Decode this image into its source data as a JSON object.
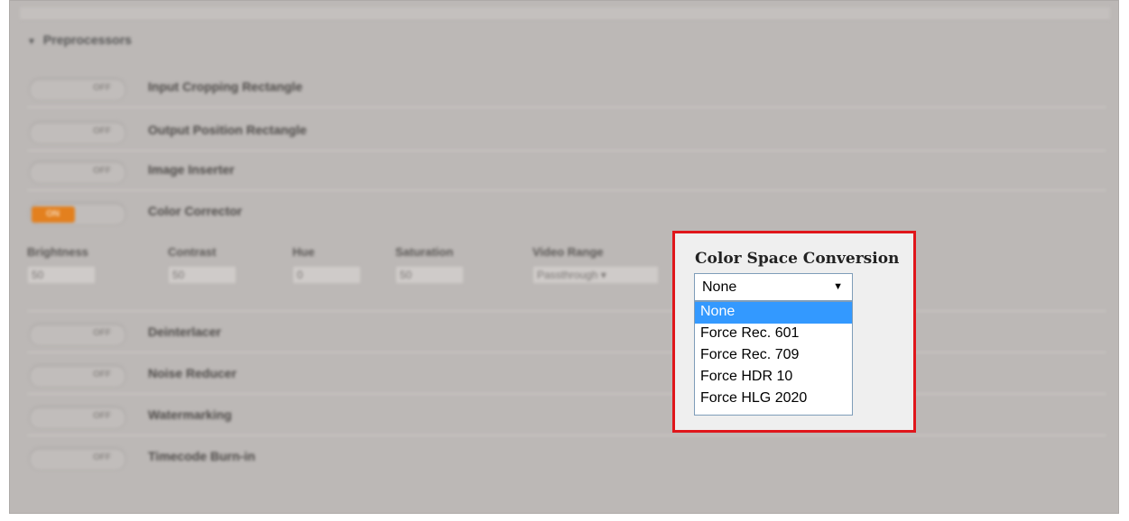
{
  "section": {
    "title": "Preprocessors"
  },
  "rows": [
    {
      "label": "Input Cropping Rectangle",
      "state": "OFF"
    },
    {
      "label": "Output Position Rectangle",
      "state": "OFF"
    },
    {
      "label": "Image Inserter",
      "state": "OFF"
    },
    {
      "label": "Color Corrector",
      "state": "ON"
    },
    {
      "label": "Deinterlacer",
      "state": "OFF"
    },
    {
      "label": "Noise Reducer",
      "state": "OFF"
    },
    {
      "label": "Watermarking",
      "state": "OFF"
    },
    {
      "label": "Timecode Burn-in",
      "state": "OFF"
    }
  ],
  "color_corrector": {
    "brightness": {
      "label": "Brightness",
      "value": "50"
    },
    "contrast": {
      "label": "Contrast",
      "value": "50"
    },
    "hue": {
      "label": "Hue",
      "value": "0"
    },
    "saturation": {
      "label": "Saturation",
      "value": "50"
    },
    "video_range": {
      "label": "Video Range",
      "value": "Passthrough ▾"
    }
  },
  "color_space": {
    "title": "Color Space Conversion",
    "selected": "None",
    "arrow": "▼",
    "options": [
      "None",
      "Force Rec. 601",
      "Force Rec. 709",
      "Force HDR 10",
      "Force HLG 2020"
    ]
  },
  "colors": {
    "highlight_border": "#e0161b",
    "selected_option": "#3399ff",
    "on_toggle": "#e3801e"
  }
}
